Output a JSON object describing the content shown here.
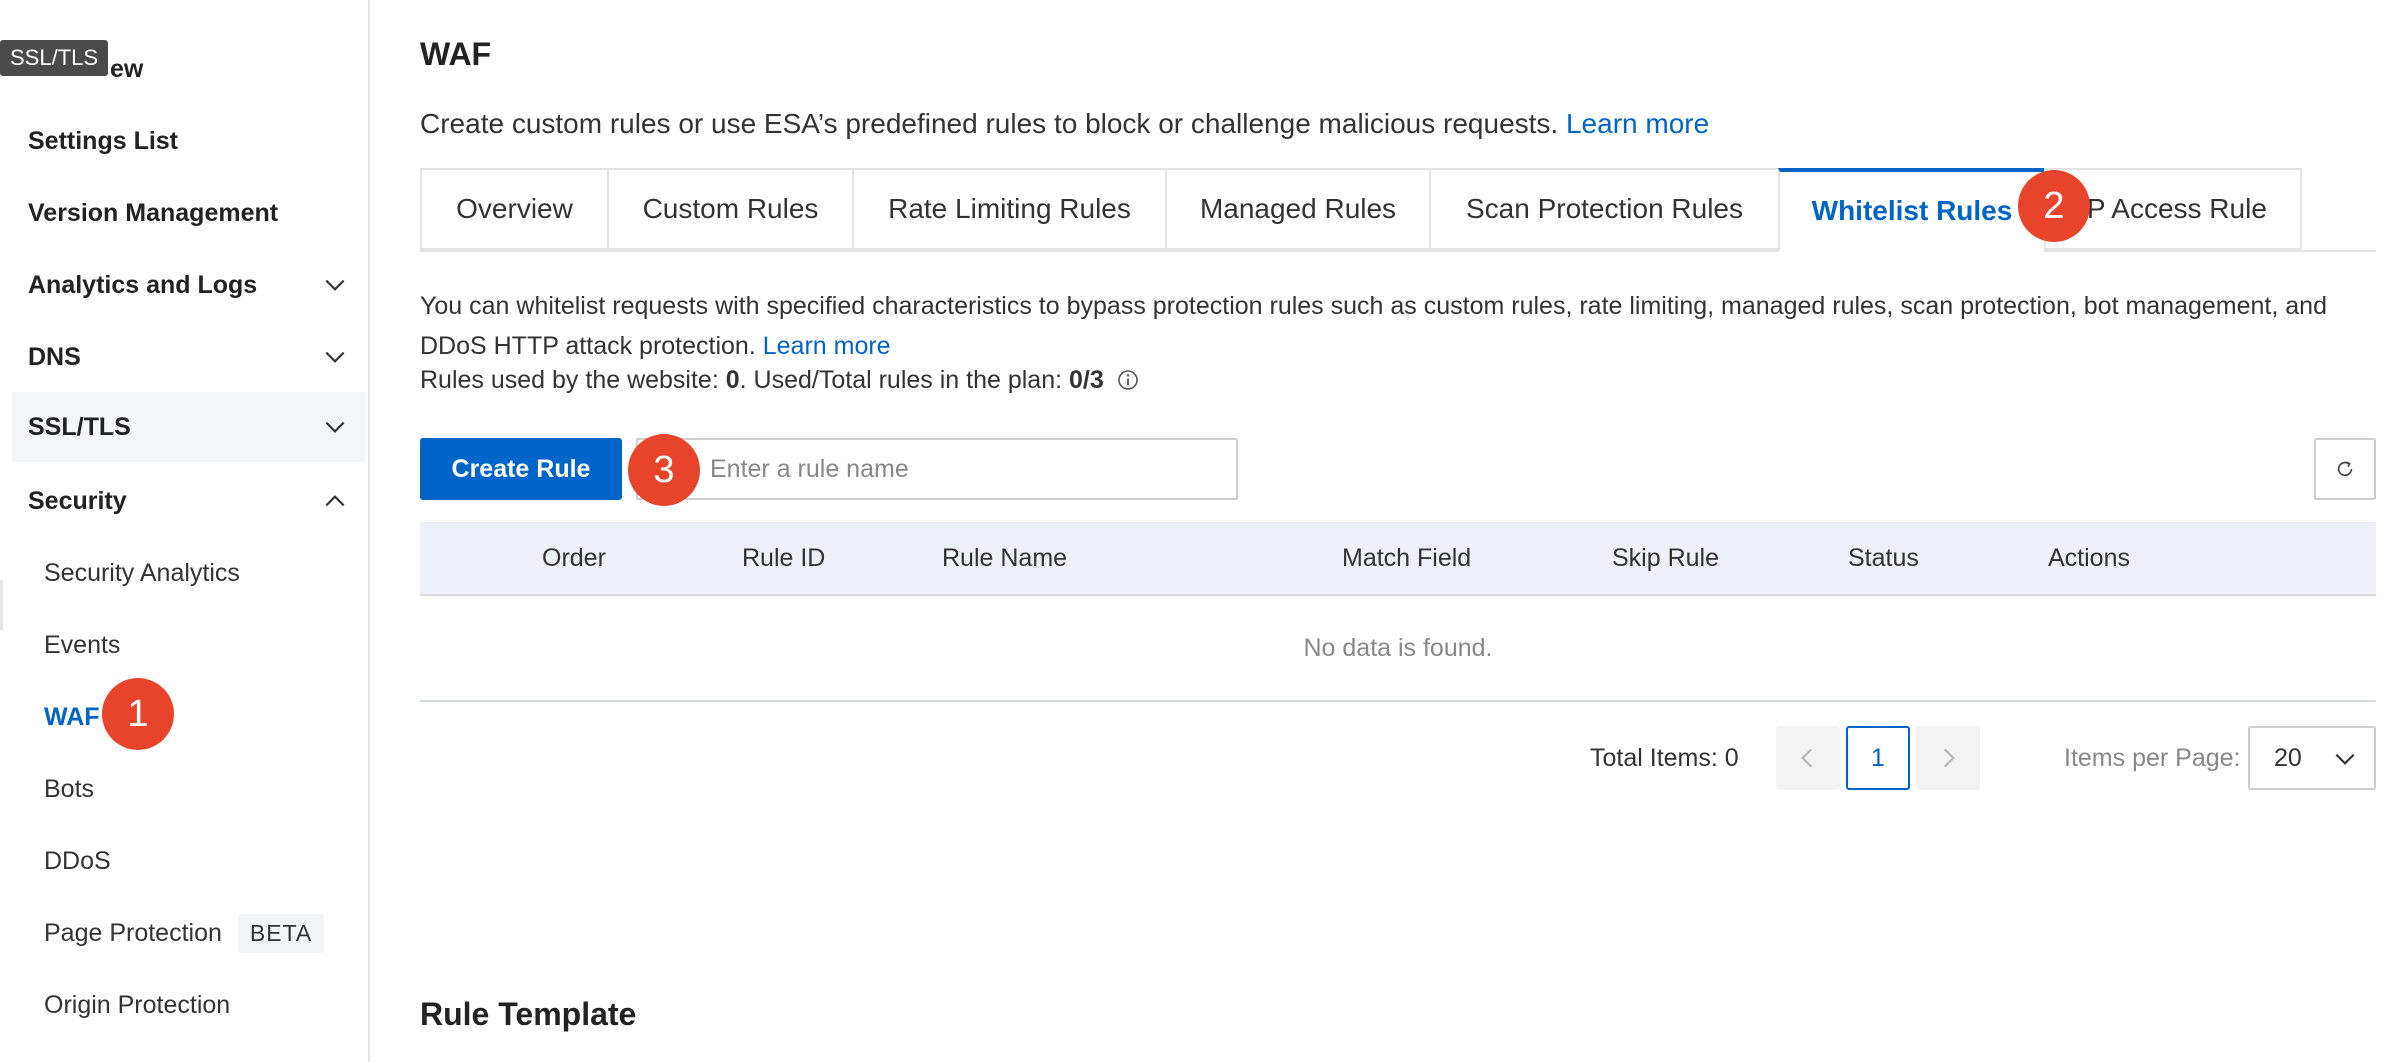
{
  "tooltip": "SSL/TLS",
  "sidebar": {
    "items": [
      {
        "label": "Overview",
        "visible_part": "ew"
      },
      {
        "label": "Settings List"
      },
      {
        "label": "Version Management"
      },
      {
        "label": "Analytics and Logs",
        "state": "collapsed"
      },
      {
        "label": "DNS",
        "state": "collapsed"
      },
      {
        "label": "SSL/TLS",
        "state": "collapsed"
      },
      {
        "label": "Security",
        "state": "expanded"
      }
    ],
    "security_children": [
      {
        "label": "Security Analytics"
      },
      {
        "label": "Events"
      },
      {
        "label": "WAF",
        "active": true
      },
      {
        "label": "Bots"
      },
      {
        "label": "DDoS"
      },
      {
        "label": "Page Protection",
        "badge": "BETA"
      },
      {
        "label": "Origin Protection"
      }
    ]
  },
  "page": {
    "title": "WAF",
    "description": "Create custom rules or use ESA’s predefined rules to block or challenge malicious requests.",
    "learn_more": "Learn more"
  },
  "tabs": [
    {
      "label": "Overview"
    },
    {
      "label": "Custom Rules"
    },
    {
      "label": "Rate Limiting Rules"
    },
    {
      "label": "Managed Rules"
    },
    {
      "label": "Scan Protection Rules"
    },
    {
      "label": "Whitelist Rules",
      "active": true
    },
    {
      "label": "IP Access Rule"
    }
  ],
  "whitelist": {
    "description": "You can whitelist requests with specified characteristics to bypass protection rules such as custom rules, rate limiting, managed rules, scan protection, bot management, and DDoS HTTP attack protection.",
    "learn_more": "Learn more",
    "rules_used_prefix": "Rules used by the website: ",
    "rules_used_value": "0",
    "plan_prefix": ". Used/Total rules in the plan: ",
    "plan_value": "0/3",
    "create_button": "Create Rule",
    "search_placeholder": "Enter a rule name"
  },
  "table": {
    "columns": [
      "Order",
      "Rule ID",
      "Rule Name",
      "Match Field",
      "Skip Rule",
      "Status",
      "Actions"
    ],
    "rows": [],
    "empty_text": "No data is found."
  },
  "pagination": {
    "total_label": "Total Items: 0",
    "current_page": "1",
    "items_per_page_label": "Items per Page:",
    "items_per_page_value": "20"
  },
  "rule_template_title": "Rule Template",
  "step_badges": [
    "1",
    "2",
    "3"
  ],
  "colors": {
    "accent": "#0064c8",
    "badge": "#e8442c",
    "table_header_bg": "#eef1f8"
  }
}
